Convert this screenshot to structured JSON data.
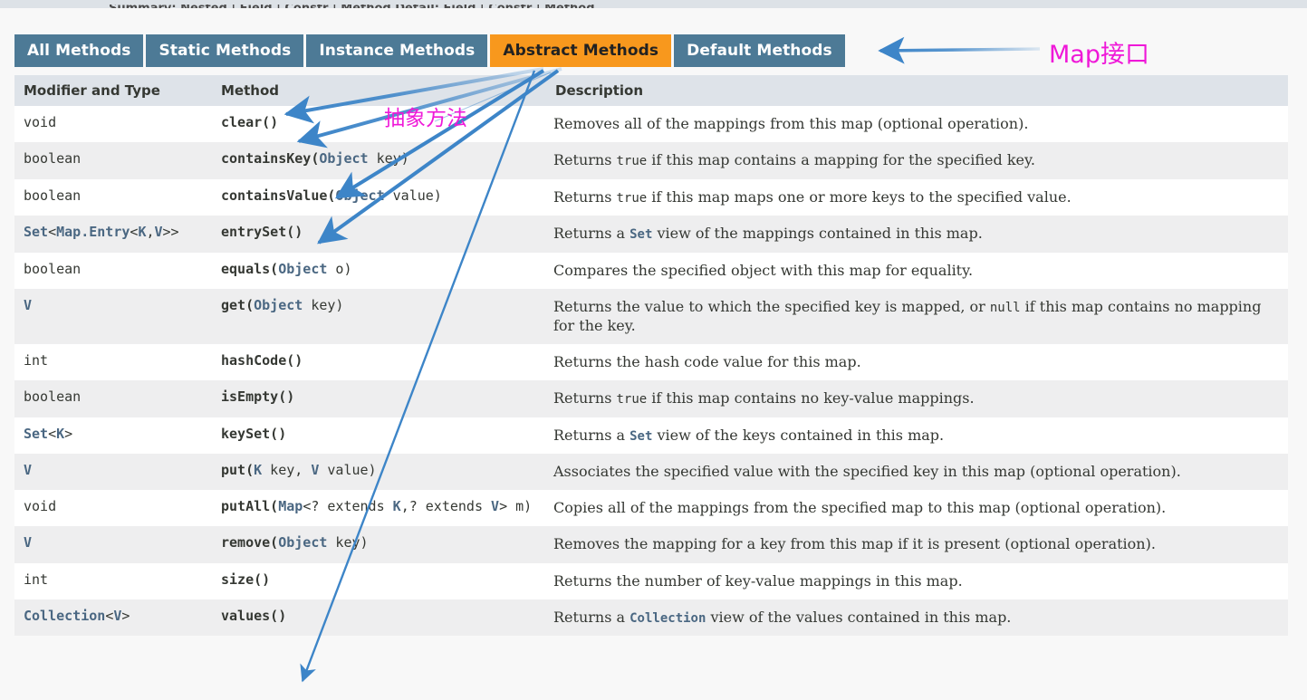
{
  "topbar": {
    "sliver_text": "Summary:   Nested  |  Field  |  Constr  |  Method                 Detail:   Field  |  Constr  |  Method"
  },
  "tabs": [
    {
      "label": "All Methods",
      "active": false
    },
    {
      "label": "Static Methods",
      "active": false
    },
    {
      "label": "Instance Methods",
      "active": false
    },
    {
      "label": "Abstract Methods",
      "active": true
    },
    {
      "label": "Default Methods",
      "active": false
    }
  ],
  "table": {
    "headers": {
      "modifier": "Modifier and Type",
      "method": "Method",
      "description": "Description"
    },
    "rows": [
      {
        "modifier_html": "void",
        "method_html": "clear()",
        "description_html": "Removes all of the mappings from this map (optional operation)."
      },
      {
        "modifier_html": "boolean",
        "method_html": "containsKey(<span class=\"lnk\">Object</span><span class=\"plain\"> key)</span>",
        "description_html": "Returns <code>true</code> if this map contains a mapping for the specified key."
      },
      {
        "modifier_html": "boolean",
        "method_html": "containsValue(<span class=\"lnk\">Object</span><span class=\"plain\"> value)</span>",
        "description_html": "Returns <code>true</code> if this map maps one or more keys to the specified value."
      },
      {
        "modifier_html": "<span class=\"lnk\">Set</span>&lt;<span class=\"lnk\">Map.Entry</span>&lt;<span class=\"lnk\">K</span>,<span class=\"lnk\">V</span>&gt;&gt;",
        "method_html": "entrySet()",
        "description_html": "Returns a <span class=\"lnk\">Set</span> view of the mappings contained in this map."
      },
      {
        "modifier_html": "boolean",
        "method_html": "equals(<span class=\"lnk\">Object</span><span class=\"plain\"> o)</span>",
        "description_html": "Compares the specified object with this map for equality."
      },
      {
        "modifier_html": "<span class=\"lnk\">V</span>",
        "method_html": "get(<span class=\"lnk\">Object</span><span class=\"plain\"> key)</span>",
        "description_html": "Returns the value to which the specified key is mapped, or <code>null</code> if this map contains no mapping for the key."
      },
      {
        "modifier_html": "int",
        "method_html": "hashCode()",
        "description_html": "Returns the hash code value for this map."
      },
      {
        "modifier_html": "boolean",
        "method_html": "isEmpty()",
        "description_html": "Returns <code>true</code> if this map contains no key-value mappings."
      },
      {
        "modifier_html": "<span class=\"lnk\">Set</span>&lt;<span class=\"lnk\">K</span>&gt;",
        "method_html": "keySet()",
        "description_html": "Returns a <span class=\"lnk\">Set</span> view of the keys contained in this map."
      },
      {
        "modifier_html": "<span class=\"lnk\">V</span>",
        "method_html": "put(<span class=\"lnk\">K</span><span class=\"plain\"> key, </span><span class=\"lnk\">V</span><span class=\"plain\"> value)</span>",
        "description_html": "Associates the specified value with the specified key in this map (optional operation)."
      },
      {
        "modifier_html": "void",
        "method_html": "putAll(<span class=\"lnk\">Map</span><span class=\"plain\">&lt;? extends </span><span class=\"lnk\">K</span><span class=\"plain\">,? extends </span><span class=\"lnk\">V</span><span class=\"plain\">&gt; m)</span>",
        "description_html": "Copies all of the mappings from the specified map to this map (optional operation)."
      },
      {
        "modifier_html": "<span class=\"lnk\">V</span>",
        "method_html": "remove(<span class=\"lnk\">Object</span><span class=\"plain\"> key)</span>",
        "description_html": "Removes the mapping for a key from this map if it is present (optional operation)."
      },
      {
        "modifier_html": "int",
        "method_html": "size()",
        "description_html": "Returns the number of key-value mappings in this map."
      },
      {
        "modifier_html": "<span class=\"lnk\">Collection</span>&lt;<span class=\"lnk\">V</span>&gt;",
        "method_html": "values()",
        "description_html": "Returns a <span class=\"lnk\">Collection</span> view of the values contained in this map."
      }
    ]
  },
  "annotations": {
    "map_interface_label": "Map接口",
    "abstract_method_label": "抽象方法"
  },
  "colors": {
    "tab_inactive_bg": "#4d7a96",
    "tab_active_bg": "#f8981d",
    "table_header_bg": "#dee3e9",
    "row_alt_bg": "#eeeeef",
    "link_text": "#4a6782",
    "annotation_pink": "#ef18d8",
    "arrow_blue": "#3d85c8",
    "page_bg": "#f8f8f8"
  }
}
